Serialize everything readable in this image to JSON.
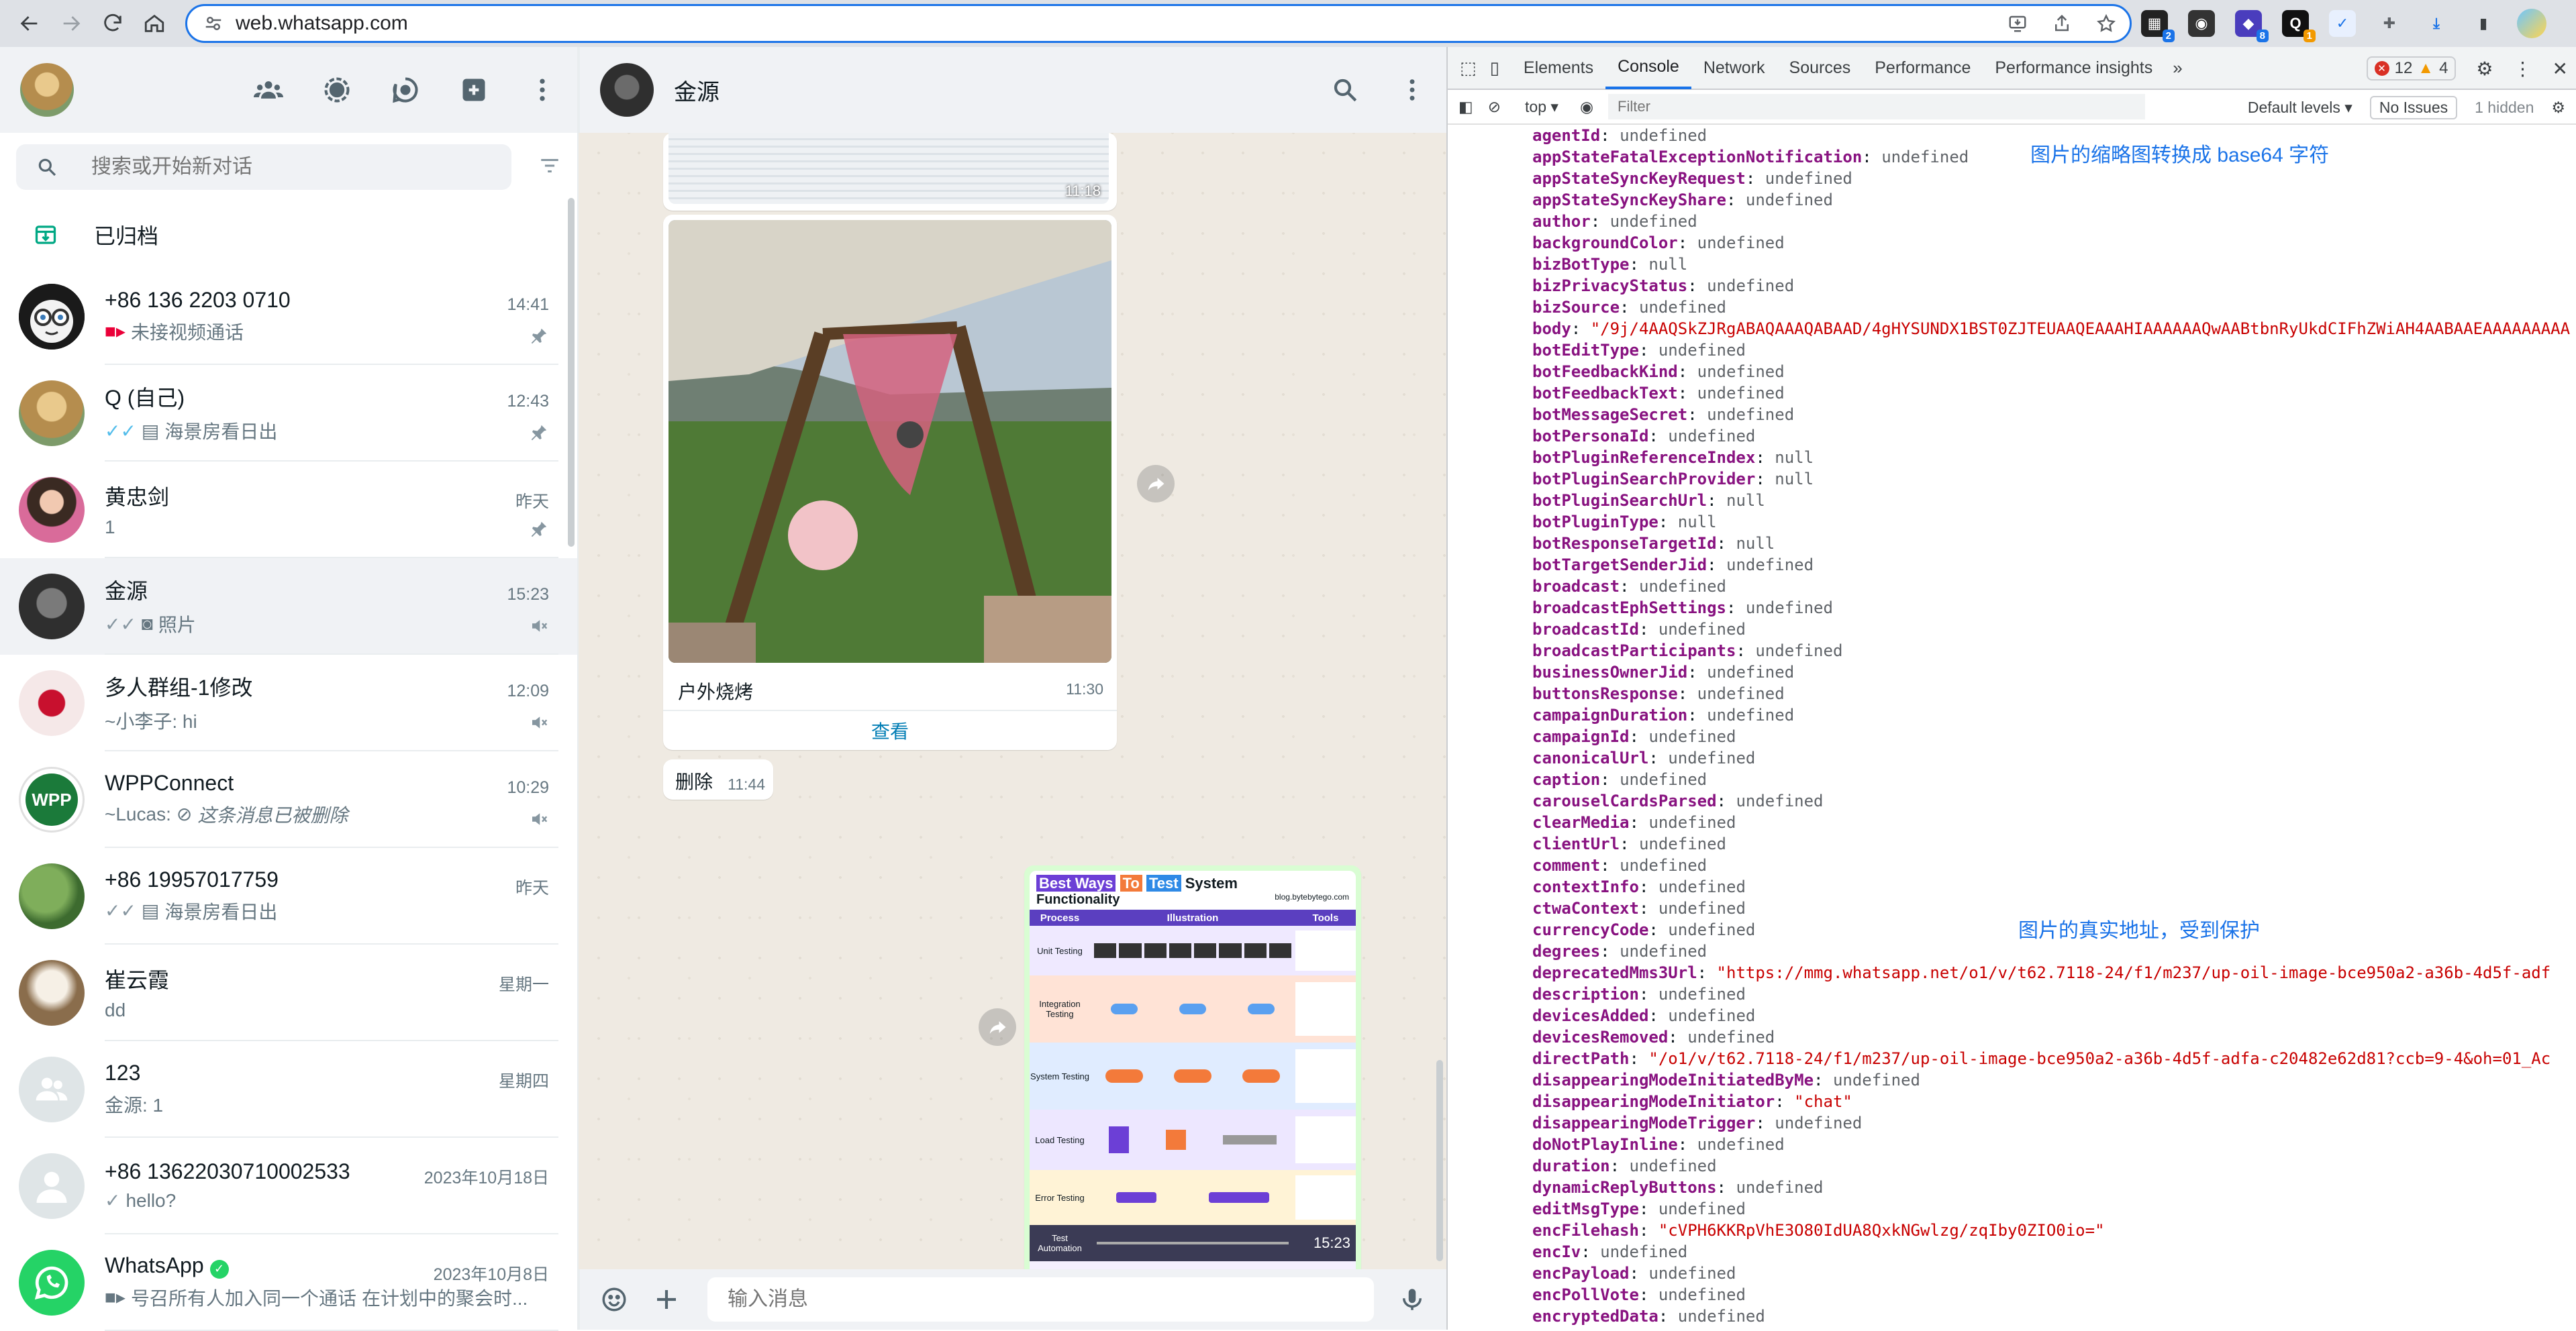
{
  "browser": {
    "url": "web.whatsapp.com"
  },
  "sidebar": {
    "search_placeholder": "搜索或开始新对话",
    "archived_label": "已归档",
    "chats": [
      {
        "name": "+86 136 2203 0710",
        "time": "14:41",
        "preview": "未接视频通话",
        "pinned": true
      },
      {
        "name": "Q (自己)",
        "time": "12:43",
        "preview": "海景房看日出",
        "pinned": true
      },
      {
        "name": "黄忠剑",
        "time": "昨天",
        "preview": "1",
        "pinned": true
      },
      {
        "name": "金源",
        "time": "15:23",
        "preview": "照片",
        "muted": true
      },
      {
        "name": "多人群组-1修改",
        "time": "12:09",
        "preview": "~小李子: hi",
        "muted": true
      },
      {
        "name": "WPPConnect",
        "time": "10:29",
        "preview": "~Lucas: ",
        "preview_deleted": "这条消息已被删除",
        "muted": true
      },
      {
        "name": "+86 19957017759",
        "time": "昨天",
        "preview": "海景房看日出"
      },
      {
        "name": "崔云霞",
        "time": "星期一",
        "preview": "dd"
      },
      {
        "name": "123",
        "time": "星期四",
        "preview": "金源: 1"
      },
      {
        "name": "+86 13622030710002533",
        "time": "2023年10月18日",
        "preview": "hello?"
      },
      {
        "name": "WhatsApp",
        "time": "2023年10月8日",
        "preview": "号召所有人加入同一个通话",
        "preview_extra": "在计划中的聚会时..."
      }
    ]
  },
  "conversation": {
    "title": "金源",
    "messages": {
      "top_image_time": "11:18",
      "photo_caption": "户外烧烤",
      "photo_time": "11:30",
      "view_label": "查看",
      "deleted_text": "删除",
      "deleted_time": "11:44",
      "infographic_time": "15:23",
      "infographic": {
        "title_parts": [
          "Best Ways",
          "To",
          "Test",
          "System"
        ],
        "subtitle": "Functionality",
        "source": "blog.bytebytego.com",
        "headers": [
          "Process",
          "Illustration",
          "Tools"
        ],
        "rows": [
          "Unit Testing",
          "Integration Testing",
          "System Testing",
          "Load Testing",
          "Error Testing",
          "Test Automation"
        ]
      }
    },
    "input_placeholder": "输入消息"
  },
  "devtools": {
    "tabs": [
      "Elements",
      "Console",
      "Network",
      "Sources",
      "Performance",
      "Performance insights"
    ],
    "active_tab": "Console",
    "error_count": "12",
    "warning_count": "4",
    "context": "top",
    "filter_placeholder": "Filter",
    "levels": "Default levels",
    "issues": "No Issues",
    "hidden": "1 hidden",
    "annotations": {
      "thumbnail": "图片的缩略图转换成 base64 字符",
      "real_url": "图片的真实地址，受到保护"
    },
    "console_lines": [
      {
        "k": "agentId",
        "v": "undefined"
      },
      {
        "k": "appStateFatalExceptionNotification",
        "v": "undefined"
      },
      {
        "k": "appStateSyncKeyRequest",
        "v": "undefined"
      },
      {
        "k": "appStateSyncKeyShare",
        "v": "undefined"
      },
      {
        "k": "author",
        "v": "undefined"
      },
      {
        "k": "backgroundColor",
        "v": "undefined"
      },
      {
        "k": "bizBotType",
        "v": "null"
      },
      {
        "k": "bizPrivacyStatus",
        "v": "undefined"
      },
      {
        "k": "bizSource",
        "v": "undefined"
      },
      {
        "k": "body",
        "v": "\"/9j/4AAQSkZJRgABAQAAAQABAAD/4gHYSUNDX1BST0ZJTEUAAQEAAAHIAAAAAAQwAABtbnRyUkdCIFhZWiAH4AABAAEAAAAAAAAA",
        "s": true
      },
      {
        "k": "botEditType",
        "v": "undefined"
      },
      {
        "k": "botFeedbackKind",
        "v": "undefined"
      },
      {
        "k": "botFeedbackText",
        "v": "undefined"
      },
      {
        "k": "botMessageSecret",
        "v": "undefined"
      },
      {
        "k": "botPersonaId",
        "v": "undefined"
      },
      {
        "k": "botPluginReferenceIndex",
        "v": "null"
      },
      {
        "k": "botPluginSearchProvider",
        "v": "null"
      },
      {
        "k": "botPluginSearchUrl",
        "v": "null"
      },
      {
        "k": "botPluginType",
        "v": "null"
      },
      {
        "k": "botResponseTargetId",
        "v": "null"
      },
      {
        "k": "botTargetSenderJid",
        "v": "undefined"
      },
      {
        "k": "broadcast",
        "v": "undefined"
      },
      {
        "k": "broadcastEphSettings",
        "v": "undefined"
      },
      {
        "k": "broadcastId",
        "v": "undefined"
      },
      {
        "k": "broadcastParticipants",
        "v": "undefined"
      },
      {
        "k": "businessOwnerJid",
        "v": "undefined"
      },
      {
        "k": "buttonsResponse",
        "v": "undefined"
      },
      {
        "k": "campaignDuration",
        "v": "undefined"
      },
      {
        "k": "campaignId",
        "v": "undefined"
      },
      {
        "k": "canonicalUrl",
        "v": "undefined"
      },
      {
        "k": "caption",
        "v": "undefined"
      },
      {
        "k": "carouselCardsParsed",
        "v": "undefined"
      },
      {
        "k": "clearMedia",
        "v": "undefined"
      },
      {
        "k": "clientUrl",
        "v": "undefined"
      },
      {
        "k": "comment",
        "v": "undefined"
      },
      {
        "k": "contextInfo",
        "v": "undefined"
      },
      {
        "k": "ctwaContext",
        "v": "undefined"
      },
      {
        "k": "currencyCode",
        "v": "undefined"
      },
      {
        "k": "degrees",
        "v": "undefined"
      },
      {
        "k": "deprecatedMms3Url",
        "v": "\"https://mmg.whatsapp.net/o1/v/t62.7118-24/f1/m237/up-oil-image-bce950a2-a36b-4d5f-adf",
        "s": true
      },
      {
        "k": "description",
        "v": "undefined"
      },
      {
        "k": "devicesAdded",
        "v": "undefined"
      },
      {
        "k": "devicesRemoved",
        "v": "undefined"
      },
      {
        "k": "directPath",
        "v": "\"/o1/v/t62.7118-24/f1/m237/up-oil-image-bce950a2-a36b-4d5f-adfa-c20482e62d81?ccb=9-4&oh=01_Ac",
        "s": true
      },
      {
        "k": "disappearingModeInitiatedByMe",
        "v": "undefined"
      },
      {
        "k": "disappearingModeInitiator",
        "v": "\"chat\"",
        "s": true
      },
      {
        "k": "disappearingModeTrigger",
        "v": "undefined"
      },
      {
        "k": "doNotPlayInline",
        "v": "undefined"
      },
      {
        "k": "duration",
        "v": "undefined"
      },
      {
        "k": "dynamicReplyButtons",
        "v": "undefined"
      },
      {
        "k": "editMsgType",
        "v": "undefined"
      },
      {
        "k": "encFilehash",
        "v": "\"cVPH6KKRpVhE3O80IdUA8QxkNGwlzg/zqIby0ZIO0io=\"",
        "s": true
      },
      {
        "k": "encIv",
        "v": "undefined"
      },
      {
        "k": "encPayload",
        "v": "undefined"
      },
      {
        "k": "encPollVote",
        "v": "undefined"
      },
      {
        "k": "encryptedData",
        "v": "undefined"
      }
    ]
  }
}
